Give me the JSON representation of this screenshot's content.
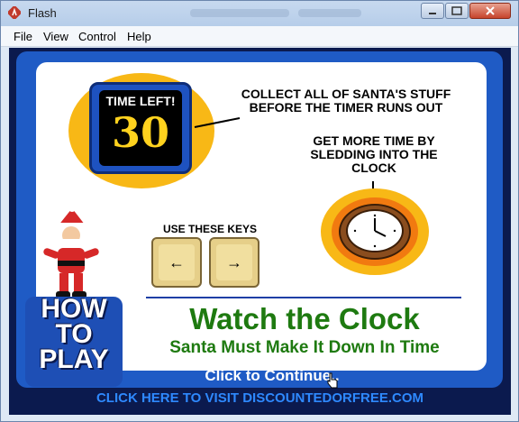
{
  "window": {
    "title": "Flash"
  },
  "menu": [
    "File",
    "View",
    "Control",
    "Help"
  ],
  "game": {
    "timer_label": "TIME LEFT!",
    "timer_value": "30",
    "instruction_1": "COLLECT ALL OF SANTA'S STUFF BEFORE THE TIMER RUNS OUT",
    "instruction_2": "GET MORE TIME BY SLEDDING INTO THE CLOCK",
    "keys_label": "USE THESE KEYS",
    "left_key": "←",
    "right_key": "→",
    "howto": "HOW TO PLAY",
    "title": "Watch the Clock",
    "subtitle": "Santa Must Make It Down In Time",
    "continue": "Click to Continue..",
    "visit": "CLICK HERE TO VISIT DISCOUNTEDORFREE.COM"
  },
  "colors": {
    "stage_bg": "#0b1a4e",
    "blue": "#1f5bc5",
    "gold": "#f8b816",
    "green": "#1e7a10"
  }
}
